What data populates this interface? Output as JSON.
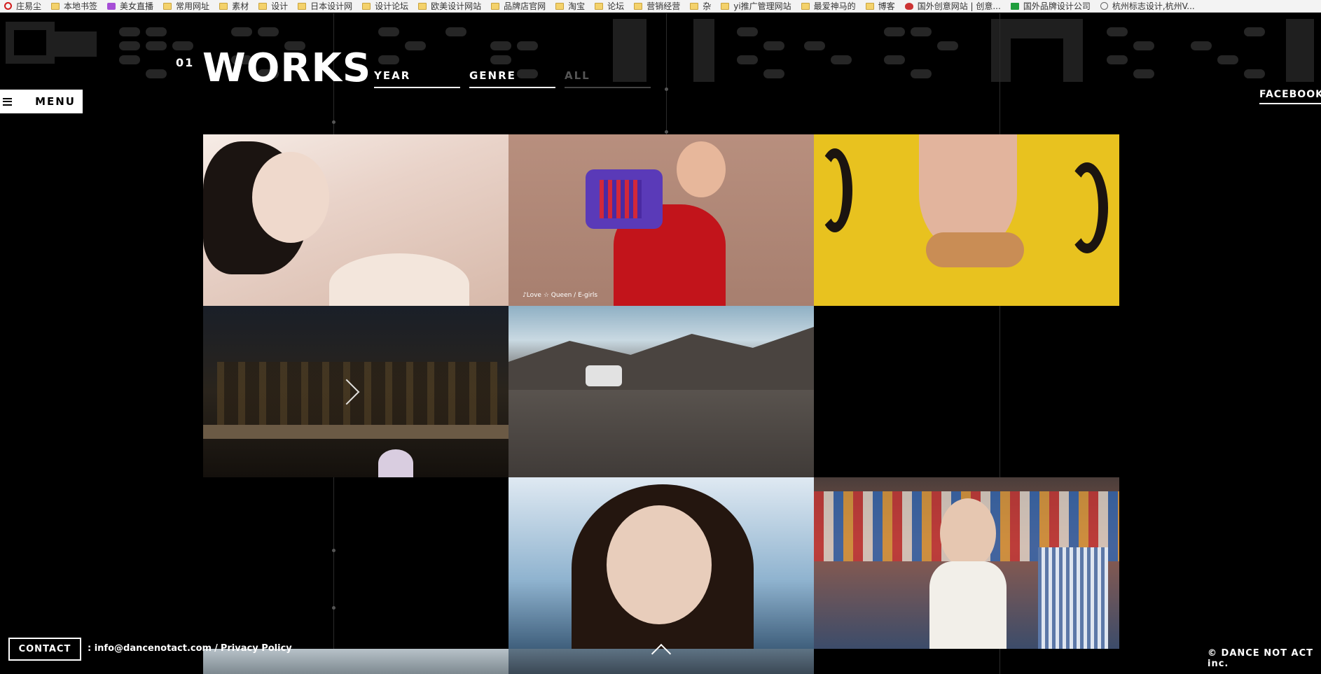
{
  "bookmarks": [
    {
      "label": "庄易尘",
      "icon": "opera-icon"
    },
    {
      "label": "本地书签",
      "icon": "folder-icon"
    },
    {
      "label": "美女直播",
      "icon": "tv-icon"
    },
    {
      "label": "常用网址",
      "icon": "folder-icon"
    },
    {
      "label": "素材",
      "icon": "folder-icon"
    },
    {
      "label": "设计",
      "icon": "folder-icon"
    },
    {
      "label": "日本设计网",
      "icon": "folder-icon"
    },
    {
      "label": "设计论坛",
      "icon": "folder-icon"
    },
    {
      "label": "欧美设计网站",
      "icon": "folder-icon"
    },
    {
      "label": "品牌店官网",
      "icon": "folder-icon"
    },
    {
      "label": "淘宝",
      "icon": "folder-icon"
    },
    {
      "label": "论坛",
      "icon": "folder-icon"
    },
    {
      "label": "营销经营",
      "icon": "folder-icon"
    },
    {
      "label": "杂",
      "icon": "folder-icon"
    },
    {
      "label": "yi推广管理网站",
      "icon": "folder-icon"
    },
    {
      "label": "最爱神马的",
      "icon": "folder-icon"
    },
    {
      "label": "博客",
      "icon": "folder-icon"
    },
    {
      "label": "国外创意网站 | 创意...",
      "icon": "shield-icon"
    },
    {
      "label": "国外品牌设计公司",
      "icon": "green-square-icon"
    },
    {
      "label": "杭州标志设计,杭州V...",
      "icon": "globe-icon"
    }
  ],
  "section": {
    "number": "01",
    "title": "WORKS"
  },
  "filters": [
    {
      "label": "YEAR",
      "active": true
    },
    {
      "label": "GENRE",
      "active": true
    },
    {
      "label": "ALL",
      "active": false
    }
  ],
  "menu": {
    "label": "MENU"
  },
  "social": {
    "facebook": "FACEBOOK"
  },
  "tiles": [
    {
      "name": "work-tile-woman-lying",
      "caption": ""
    },
    {
      "name": "work-tile-red-dress-bag",
      "caption": "♪Love ☆ Queen / E-girls"
    },
    {
      "name": "work-tile-yellow-question",
      "caption": ""
    },
    {
      "name": "work-tile-palace-night",
      "caption": ""
    },
    {
      "name": "work-tile-mountain-car",
      "caption": ""
    },
    {
      "name": "work-tile-portrait-blue",
      "caption": ""
    },
    {
      "name": "work-tile-clothing-store",
      "caption": ""
    }
  ],
  "footer": {
    "contact_label": "CONTACT",
    "email": ": info@dancenotact.com",
    "separator": "/",
    "privacy": "Privacy Policy",
    "copyright": "© DANCE NOT ACT inc."
  }
}
